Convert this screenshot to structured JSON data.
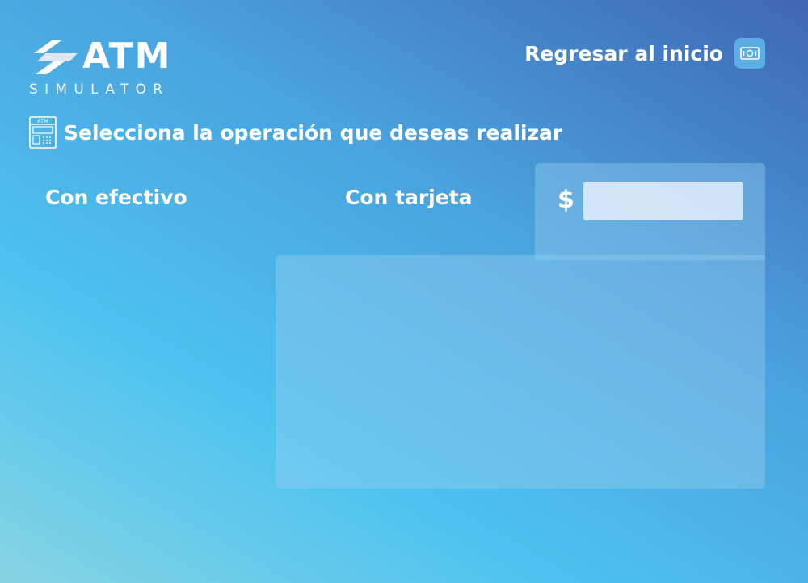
{
  "logo": {
    "title": "ATM",
    "subtitle": "SIMULATOR"
  },
  "header": {
    "back_label": "Regresar al inicio",
    "back_icon": "cash-icon"
  },
  "main": {
    "heading": "Selecciona la operación que deseas realizar",
    "heading_icon": "atm-machine-icon",
    "atm_icon_text": "ATM",
    "tabs": [
      {
        "label": "Con efectivo"
      },
      {
        "label": "Con tarjeta"
      }
    ],
    "amount": {
      "currency_symbol": "$",
      "value": "",
      "placeholder": ""
    }
  },
  "colors": {
    "gradient_start": "#86d3e2",
    "gradient_mid": "#4dc3f0",
    "gradient_end": "#3f66b3",
    "text": "#ffffff",
    "panel": "#96cdee"
  }
}
